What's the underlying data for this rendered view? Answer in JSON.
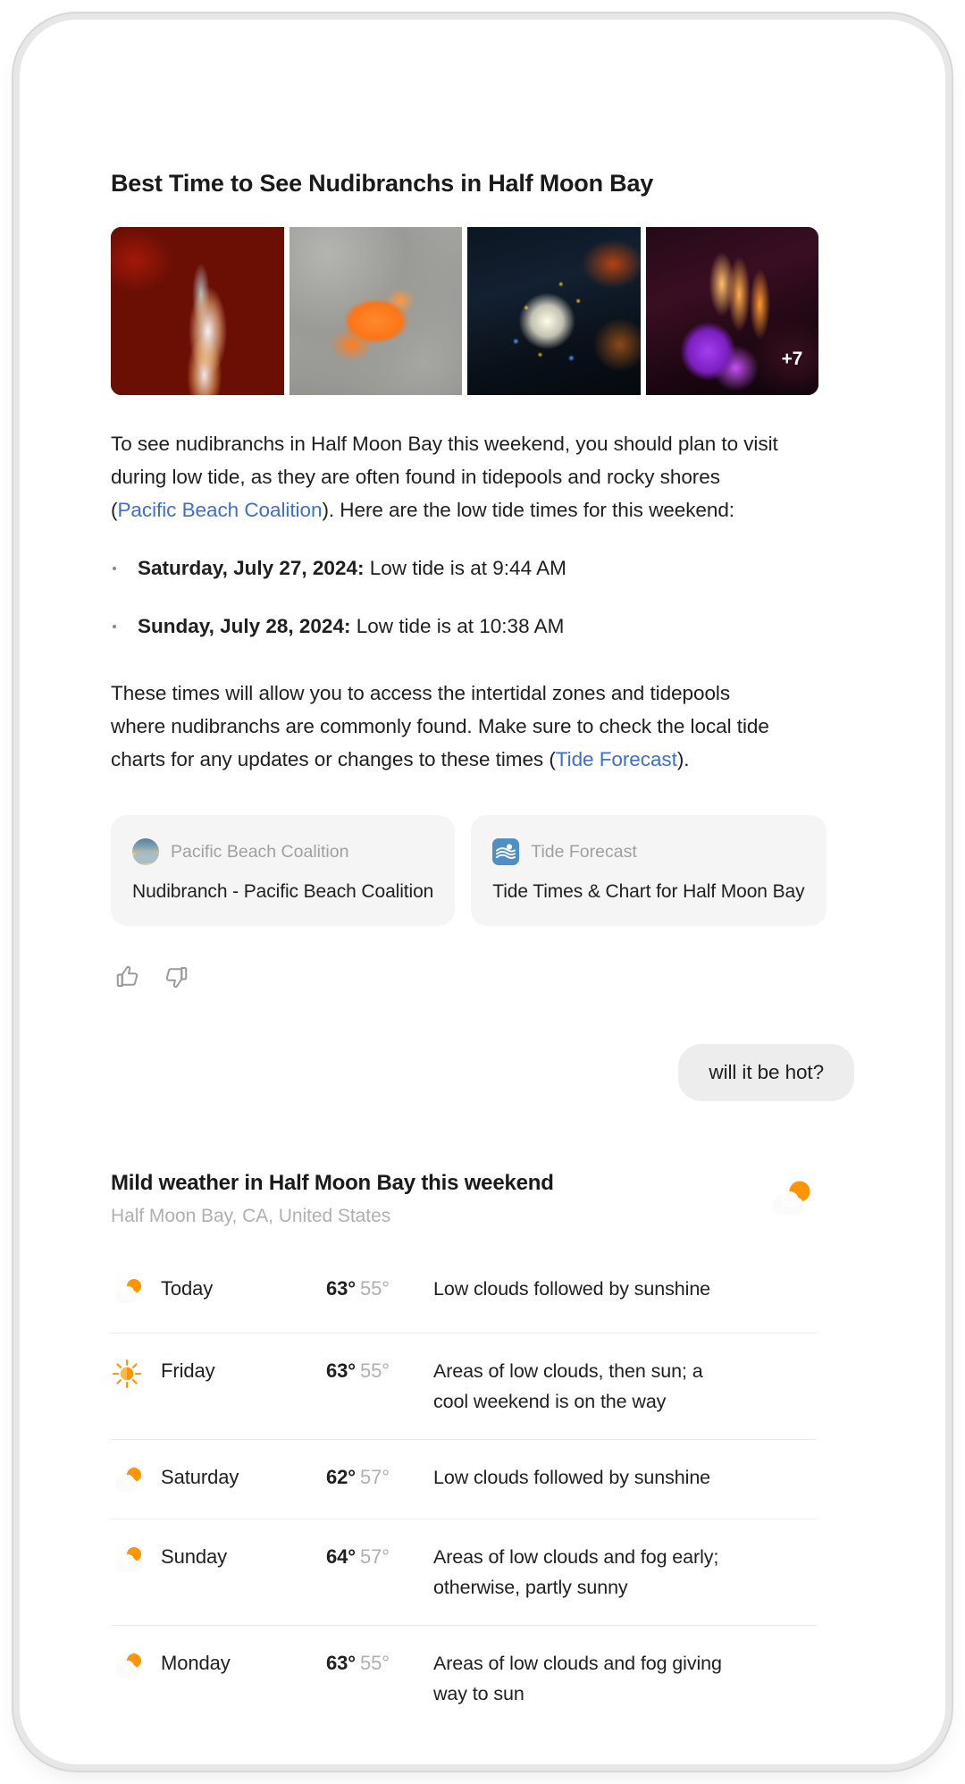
{
  "answer": {
    "headline": "Best Time to See Nudibranchs in Half Moon Bay",
    "gallery": {
      "more_badge": "+7",
      "images": [
        {
          "alt": "orange nudibranch on red algae"
        },
        {
          "alt": "orange dorid nudibranch on grey rock"
        },
        {
          "alt": "white aeolid nudibranch with yellow and blue cerata"
        },
        {
          "alt": "purple and orange flabellina nudibranch"
        }
      ]
    },
    "paragraph_1": {
      "before_link": "To see nudibranchs in Half Moon Bay this weekend, you should plan to visit during low tide, as they are often found in tidepools and rocky shores (",
      "link": "Pacific Beach Coalition",
      "after_link": "). Here are the low tide times for this weekend:"
    },
    "tide_bullets": [
      {
        "label": "Saturday, July 27, 2024:",
        "value": " Low tide is at 9:44 AM"
      },
      {
        "label": "Sunday, July 28, 2024:",
        "value": " Low tide is at 10:38 AM"
      }
    ],
    "paragraph_2": {
      "before_link": "These times will allow you to access the intertidal zones and tidepools where nudibranchs are commonly found. Make sure to check the local tide charts for any updates or changes to these times (",
      "link": "Tide Forecast",
      "after_link": ")."
    },
    "sources": [
      {
        "site": "Pacific Beach Coalition",
        "title": "Nudibranch - Pacific Beach Coalition",
        "favicon": "beach-photo-icon"
      },
      {
        "site": "Tide Forecast",
        "title": "Tide Times & Chart for Half Moon Bay",
        "favicon": "tide-waves-icon"
      }
    ],
    "feedback": {
      "thumbs_up": "thumbs-up-icon",
      "thumbs_down": "thumbs-down-icon"
    }
  },
  "user_message": {
    "text": "will it be hot?"
  },
  "weather": {
    "title": "Mild weather in Half Moon Bay this weekend",
    "subtitle": "Half Moon Bay, CA, United States",
    "header_icon": "partly-cloudy-icon",
    "forecast": [
      {
        "day": "Today",
        "icon": "partly-cloudy-icon",
        "high": "63°",
        "low": "55°",
        "description": "Low clouds followed by sunshine"
      },
      {
        "day": "Friday",
        "icon": "sunny-icon",
        "high": "63°",
        "low": "55°",
        "description": "Areas of low clouds, then sun; a cool weekend is on the way"
      },
      {
        "day": "Saturday",
        "icon": "partly-cloudy-icon",
        "high": "62°",
        "low": "57°",
        "description": "Low clouds followed by sunshine"
      },
      {
        "day": "Sunday",
        "icon": "partly-cloudy-icon",
        "high": "64°",
        "low": "57°",
        "description": "Areas of low clouds and fog early; otherwise, partly sunny"
      },
      {
        "day": "Monday",
        "icon": "partly-cloudy-icon",
        "high": "63°",
        "low": "55°",
        "description": "Areas of low clouds and fog giving way to sun"
      }
    ]
  },
  "colors": {
    "link": "#3b6fd4",
    "sun": "#ff9500",
    "cloud": "#f7f7f7",
    "muted": "#b0b0b0",
    "bubble_bg": "#ededed",
    "card_bg": "#f5f5f5"
  }
}
